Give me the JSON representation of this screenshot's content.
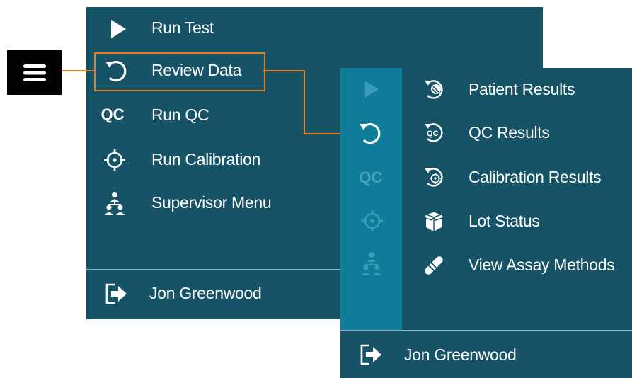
{
  "main_menu": {
    "items": [
      {
        "label": "Run Test",
        "icon": "play-icon"
      },
      {
        "label": "Review Data",
        "icon": "undo-arrow-icon"
      },
      {
        "label": "Run QC",
        "icon": "qc-icon",
        "icon_text": "QC"
      },
      {
        "label": "Run Calibration",
        "icon": "crosshair-icon"
      },
      {
        "label": "Supervisor Menu",
        "icon": "hierarchy-icon"
      }
    ],
    "user": {
      "name": "Jon Greenwood",
      "icon": "logout-icon"
    }
  },
  "sub_menu": {
    "rail_icons": [
      "play-icon",
      "undo-arrow-icon",
      "qc-icon",
      "crosshair-icon",
      "hierarchy-icon"
    ],
    "rail_qc_text": "QC",
    "items": [
      {
        "label": "Patient Results",
        "icon": "patient-results-icon"
      },
      {
        "label": "QC Results",
        "icon": "qc-results-icon",
        "icon_text": "QC"
      },
      {
        "label": "Calibration Results",
        "icon": "calibration-results-icon"
      },
      {
        "label": "Lot Status",
        "icon": "box-icon"
      },
      {
        "label": "View Assay Methods",
        "icon": "test-tube-icon"
      }
    ],
    "user": {
      "name": "Jon Greenwood",
      "icon": "logout-icon"
    }
  },
  "colors": {
    "panel": "#165367",
    "rail": "#0f7d99",
    "accent": "#e87d1e"
  },
  "hamburger": {
    "icon": "hamburger-menu-icon"
  }
}
